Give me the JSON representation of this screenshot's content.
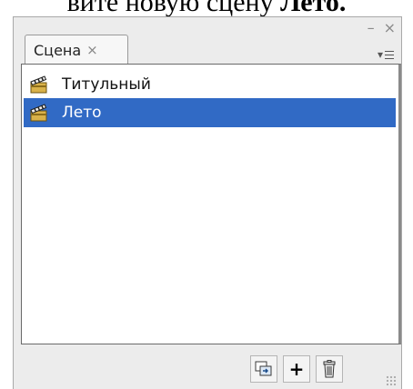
{
  "caption": {
    "prefix": "вите новую сцену ",
    "bold": "Лето."
  },
  "window": {
    "minimize_label": "–",
    "close_label": "×"
  },
  "tab": {
    "label": "Сцена",
    "close_label": "×"
  },
  "panel_menu": {
    "arrow": "▾"
  },
  "scenes": [
    {
      "name": "Титульный",
      "selected": false,
      "icon": "clapperboard-icon"
    },
    {
      "name": "Лето",
      "selected": true,
      "icon": "clapperboard-icon"
    }
  ],
  "toolbar": {
    "add_label": "+",
    "buttons": [
      "duplicate-scene-icon",
      "add-scene",
      "trash-icon"
    ]
  },
  "colors": {
    "selection": "#316ac5",
    "panel": "#ececec"
  }
}
